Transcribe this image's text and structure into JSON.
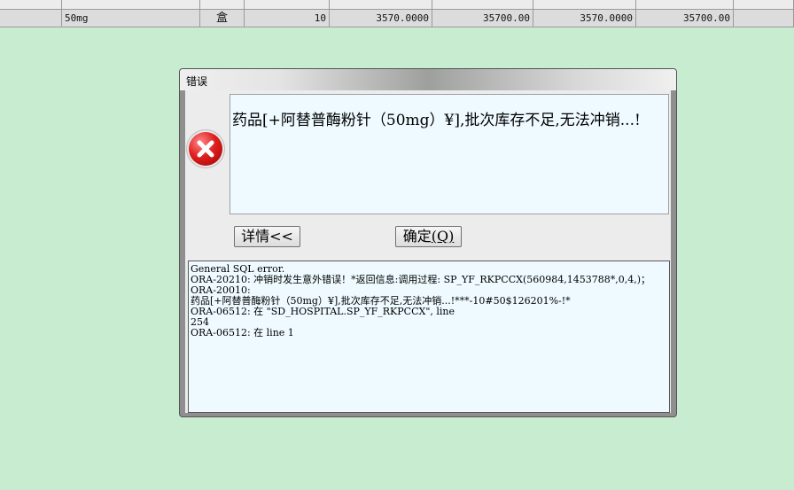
{
  "grid": {
    "data_row": {
      "spec": "50mg",
      "unit": "盒",
      "quantity": "10",
      "price1": "3570.0000",
      "amount1": "35700.00",
      "price2": "3570.0000",
      "amount2": "35700.00"
    }
  },
  "dialog": {
    "title": "错误",
    "icon": "error-icon",
    "message": "药品[+阿替普酶粉针（50mg）¥],批次库存不足,无法冲销...!",
    "details_button": "详情<<",
    "ok_button_label": "确定",
    "ok_button_accel": "(Q)",
    "details_lines": [
      "General SQL error.",
      "ORA-20210: 冲销时发生意外错误！*返回信息:调用过程: SP_YF_RKPCCX(560984,1453788*,0,4,)；",
      "ORA-20010:",
      "药品[+阿替普酶粉针（50mg）¥],批次库存不足,无法冲销...!***-10#50$126201%-!*",
      "ORA-06512: 在 \"SD_HOSPITAL.SP_YF_RKPCCX\", line",
      "254",
      "ORA-06512: 在 line 1"
    ]
  },
  "colors": {
    "desktop_bg": "#c8ecd0",
    "message_bg": "#eefaff",
    "error_red": "#e02020"
  }
}
